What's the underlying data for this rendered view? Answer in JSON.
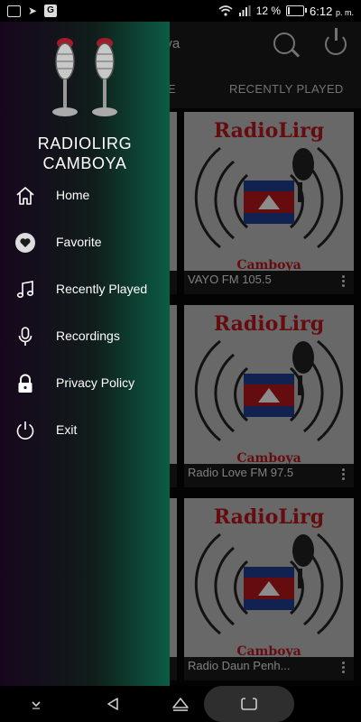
{
  "status_bar": {
    "battery_text": "12 %",
    "battery_level": 0.12,
    "time": "6:12",
    "ampm": "p. m.",
    "icons": [
      "image-icon",
      "send-icon",
      "translate-icon",
      "wifi-icon",
      "signal-icon",
      "battery-icon"
    ]
  },
  "app_bar": {
    "title_fragment": "oya",
    "search_icon": "search-icon",
    "power_icon": "power-icon"
  },
  "tabs": [
    {
      "label": "E"
    },
    {
      "label": "RECENTLY PLAYED"
    }
  ],
  "stations": [
    {
      "name": "VAYO FM 105.5"
    },
    {
      "name": "Radio Love FM 97.5"
    },
    {
      "name": "Radio Daun Penh..."
    }
  ],
  "card_logo": {
    "brand": "RadioLirg",
    "country": "Camboya",
    "colors": {
      "red": "#b8161d",
      "blue": "#1f3d92"
    }
  },
  "drawer": {
    "title_line1": "RADIOLIRG",
    "title_line2": "CAMBOYA",
    "items": [
      {
        "label": "Home",
        "icon": "home-icon"
      },
      {
        "label": "Favorite",
        "icon": "heart-icon"
      },
      {
        "label": "Recently Played",
        "icon": "music-note-icon"
      },
      {
        "label": "Recordings",
        "icon": "microphone-icon"
      },
      {
        "label": "Privacy Policy",
        "icon": "lock-icon"
      },
      {
        "label": "Exit",
        "icon": "power-icon"
      }
    ],
    "gradient": {
      "start": "#17061d",
      "end": "#0b5c45"
    }
  },
  "nav_bar": {
    "icons": [
      "chevron-down-icon",
      "back-icon",
      "home-icon",
      "recents-icon"
    ]
  }
}
